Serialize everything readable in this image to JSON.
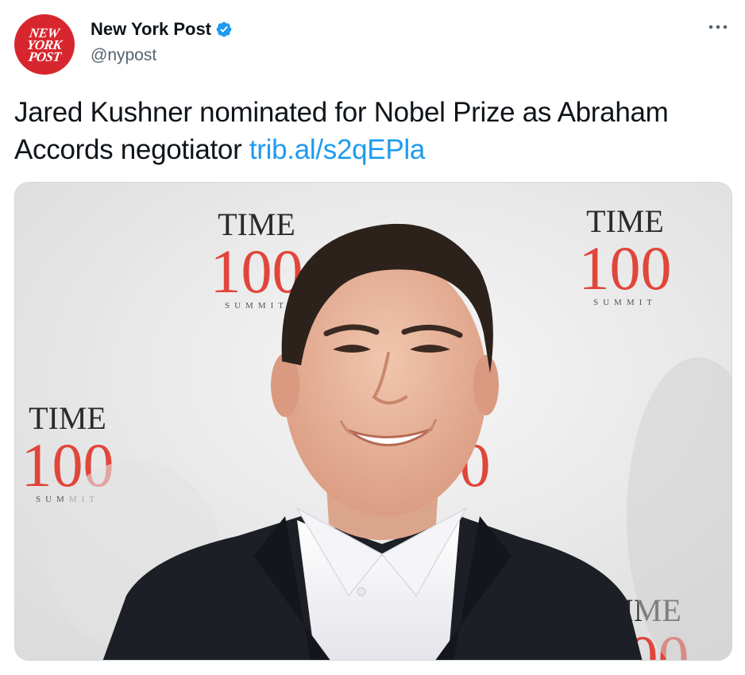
{
  "author": {
    "display_name": "New York Post",
    "handle": "@nypost",
    "avatar_logo_lines": [
      "NEW",
      "YORK",
      "POST"
    ],
    "verified": true,
    "avatar_color": "#d8262e"
  },
  "tweet": {
    "text": "Jared Kushner nominated for Nobel Prize as Abraham Accords negotiator ",
    "link": "trib.al/s2qEPla"
  },
  "media": {
    "backdrop_logo": {
      "word": "TIME",
      "number": "100",
      "event": "SUMMIT"
    }
  },
  "colors": {
    "link": "#1d9bf0",
    "verified": "#1d9bf0",
    "secondary_text": "#536471",
    "time_red": "#e0463a"
  },
  "icons": {
    "more": "more-horizontal-icon",
    "verified": "verified-badge-icon"
  }
}
